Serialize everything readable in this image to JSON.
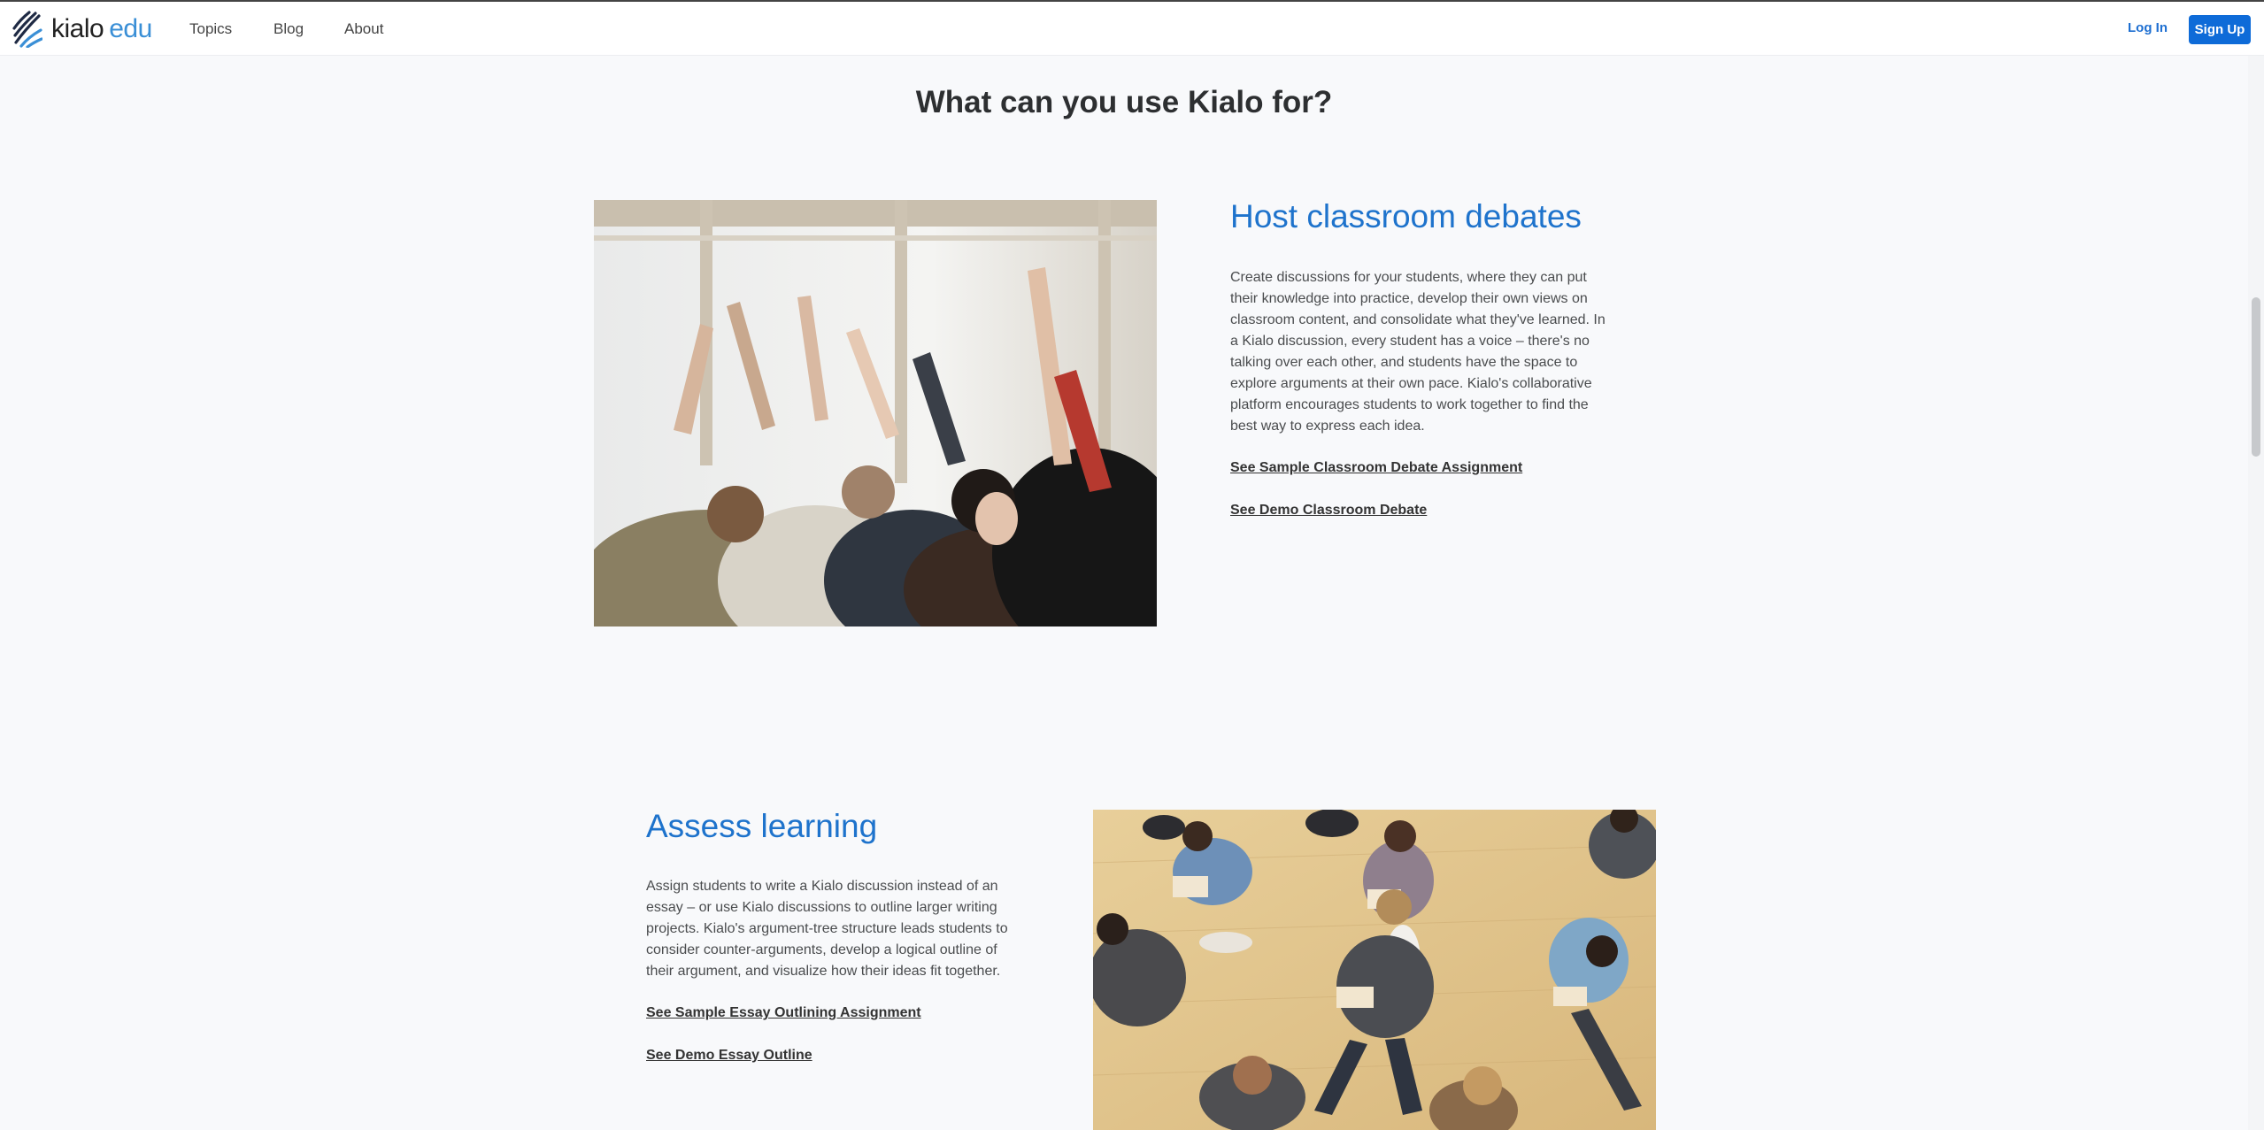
{
  "nav": {
    "logo_kialo": "kialo",
    "logo_edu": "edu",
    "links": [
      "Topics",
      "Blog",
      "About"
    ],
    "login": "Log In",
    "signup": "Sign Up"
  },
  "page": {
    "heading": "What can you use Kialo for?"
  },
  "features": [
    {
      "title": "Host classroom debates",
      "text": "Create discussions for your students, where they can put their knowledge into practice, develop their own views on classroom content, and consolidate what they've learned. In a Kialo discussion, every student has a voice – there's no talking over each other, and students have the space to explore arguments at their own pace. Kialo's collaborative platform encourages students to work together to find the best way to express each idea.",
      "link1": "See Sample Classroom Debate Assignment",
      "link2": "See Demo Classroom Debate"
    },
    {
      "title": "Assess learning",
      "text": "Assign students to write a Kialo discussion instead of an essay – or use Kialo discussions to outline larger writing projects. Kialo's argument-tree structure leads students to consider counter-arguments, develop a logical outline of their argument, and visualize how their ideas fit together.",
      "link1": "See Sample Essay Outlining Assignment",
      "link2": "See Demo Essay Outline"
    }
  ],
  "colors": {
    "accent": "#1e73cc",
    "button": "#0e6bd8",
    "background": "#f8f9fb"
  }
}
